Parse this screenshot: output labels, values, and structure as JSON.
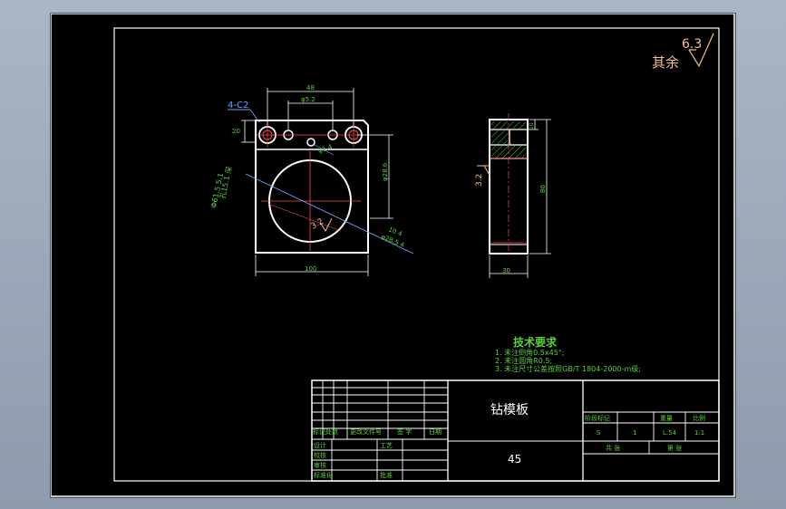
{
  "roughness": {
    "label": "其余",
    "value": "6.3"
  },
  "front_view": {
    "dims": {
      "width": "100",
      "hole_spacing": "φ5.2",
      "top_holes_outer": "48",
      "chamfer": "4-C2",
      "left_small": "20",
      "center_hole": "φ1.4",
      "right_height": "φ28.6",
      "bore_note": "Φ61.5 5.1",
      "bore_note2": "孔15.1 深",
      "right_note": "10 4",
      "diag_note": "φ28.5 4",
      "roughness_3_2": "3.2"
    }
  },
  "side_view": {
    "dims": {
      "height": "80",
      "width": "30",
      "top": "10",
      "roughness_3_2": "3.2"
    }
  },
  "tech_req": {
    "title": "技术要求",
    "items": [
      "1.  未注倒角0.5x45°;",
      "2.  未注圆角R0.5;",
      "3.  未注尺寸公差按照GB/T 1804-2000-m级;"
    ]
  },
  "title_block": {
    "part_name": "钻模板",
    "material": "45",
    "headers": [
      "标记",
      "处数",
      "更改文件号",
      "签 字",
      "日期"
    ],
    "row_labels": [
      "设计",
      "校核",
      "审核",
      "工艺"
    ],
    "standardization": "标准化",
    "approval": "批准",
    "stage_label": "阶段标记",
    "weight_label": "重量",
    "scale_label": "比例",
    "stage_value": "S",
    "weight_value": "L.54",
    "scale_value": "1:1",
    "sheets_label": "共 张",
    "sheet_label": "第 张",
    "mark_value": "1"
  }
}
